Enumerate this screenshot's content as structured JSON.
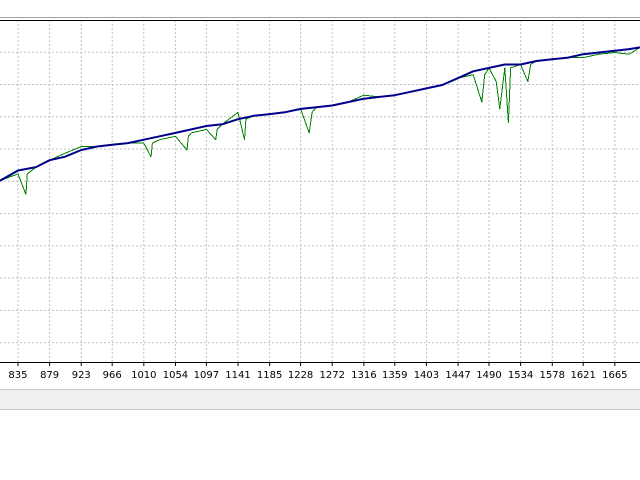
{
  "colors": {
    "balance": "#00008b",
    "equity": "#008000",
    "grid": "#c0c0c0",
    "axis": "#000000",
    "status_bar": "#f0f0f0"
  },
  "chart_data": {
    "type": "line",
    "title": "",
    "xlabel": "",
    "ylabel": "",
    "grid": true,
    "x_ticks": [
      "835",
      "879",
      "923",
      "966",
      "1010",
      "1054",
      "1097",
      "1141",
      "1185",
      "1228",
      "1272",
      "1316",
      "1359",
      "1403",
      "1447",
      "1490",
      "1534",
      "1578",
      "1621",
      "1665"
    ],
    "xlim": [
      810,
      1700
    ],
    "ylim": [
      0,
      100
    ],
    "series": [
      {
        "key": "balance",
        "color": "#00008b",
        "x": [
          810,
          835,
          860,
          879,
          900,
          923,
          945,
          966,
          988,
          1010,
          1032,
          1054,
          1076,
          1097,
          1119,
          1141,
          1163,
          1185,
          1206,
          1228,
          1250,
          1272,
          1294,
          1316,
          1338,
          1359,
          1381,
          1403,
          1425,
          1447,
          1468,
          1490,
          1512,
          1534,
          1556,
          1578,
          1600,
          1621,
          1643,
          1665,
          1685,
          1700
        ],
        "y": [
          53,
          56,
          57,
          59,
          60,
          62,
          63,
          63.5,
          64,
          65,
          66,
          67,
          68,
          69,
          69.5,
          71,
          72,
          72.5,
          73,
          74,
          74.5,
          75,
          76,
          77,
          77.5,
          78,
          79,
          80,
          81,
          83,
          85,
          86,
          87,
          87,
          88,
          88.5,
          89,
          90,
          90.5,
          91,
          91.5,
          92
        ]
      },
      {
        "key": "equity",
        "color": "#008000",
        "x": [
          810,
          835,
          846,
          848,
          860,
          879,
          900,
          923,
          945,
          966,
          988,
          1010,
          1020,
          1022,
          1032,
          1054,
          1070,
          1072,
          1076,
          1097,
          1110,
          1112,
          1119,
          1141,
          1150,
          1152,
          1163,
          1185,
          1206,
          1228,
          1240,
          1244,
          1250,
          1272,
          1294,
          1316,
          1338,
          1359,
          1381,
          1403,
          1425,
          1447,
          1468,
          1480,
          1484,
          1490,
          1500,
          1505,
          1512,
          1517,
          1520,
          1534,
          1544,
          1548,
          1556,
          1578,
          1600,
          1621,
          1643,
          1665,
          1685,
          1700
        ],
        "y": [
          53,
          55,
          49,
          55,
          57,
          59,
          61,
          63,
          63,
          63.5,
          64,
          64,
          60,
          64,
          65,
          66,
          62,
          66,
          67,
          68,
          65,
          68,
          69.5,
          73,
          65,
          71,
          72,
          72.5,
          73,
          74,
          67,
          73,
          74.5,
          75,
          76,
          78,
          77.5,
          78,
          79,
          80,
          81,
          83,
          84,
          76,
          84,
          86,
          82,
          74,
          86,
          70,
          86,
          87,
          82,
          87,
          88,
          88.5,
          89,
          89,
          90,
          90.5,
          90,
          92
        ]
      }
    ]
  }
}
